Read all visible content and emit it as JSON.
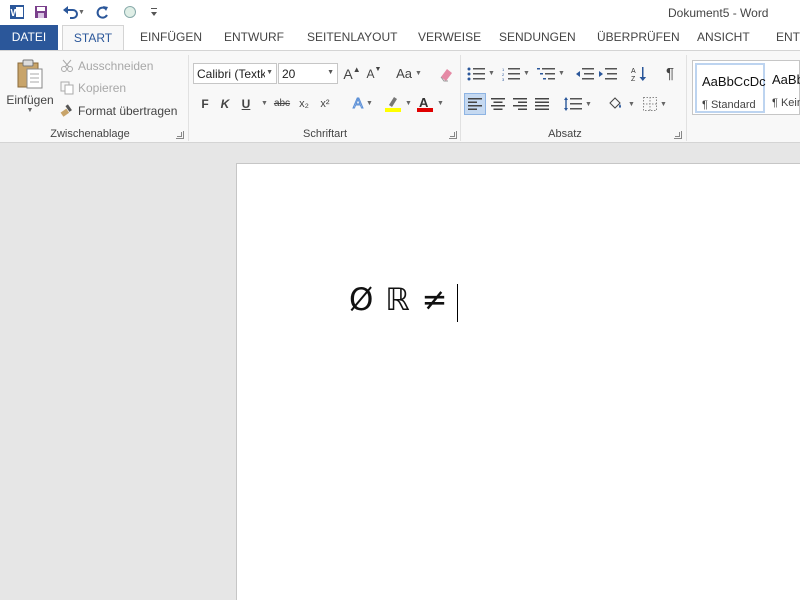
{
  "window": {
    "title": "Dokument5 - Word"
  },
  "quick_access": {
    "word_icon": "word-logo-icon",
    "save_icon": "save-icon",
    "undo_icon": "undo-icon",
    "redo_icon": "redo-icon",
    "touch_icon": "touch-mode-icon",
    "customize_icon": "customize-qat-icon"
  },
  "tabs": [
    {
      "label": "DATEI"
    },
    {
      "label": "START"
    },
    {
      "label": "EINFÜGEN"
    },
    {
      "label": "ENTWURF"
    },
    {
      "label": "SEITENLAYOUT"
    },
    {
      "label": "VERWEISE"
    },
    {
      "label": "SENDUNGEN"
    },
    {
      "label": "ÜBERPRÜFEN"
    },
    {
      "label": "ANSICHT"
    },
    {
      "label": "ENTW"
    }
  ],
  "clipboard": {
    "paste_label": "Einfügen",
    "cut_label": "Ausschneiden",
    "copy_label": "Kopieren",
    "format_painter_label": "Format übertragen",
    "group_label": "Zwischenablage"
  },
  "font": {
    "font_name": "Calibri (Textk",
    "font_size": "20",
    "bold": "F",
    "italic": "K",
    "underline": "U",
    "strike": "abc",
    "subscript": "x₂",
    "superscript": "x²",
    "grow": "A",
    "shrink": "A",
    "case": "Aa",
    "effects": "A",
    "font_color": "A",
    "highlight_color": "#ffff00",
    "font_color_value": "#e00000",
    "group_label": "Schriftart"
  },
  "paragraph": {
    "group_label": "Absatz",
    "pilcrow": "¶"
  },
  "styles": {
    "items": [
      {
        "sample": "AaBbCcDc",
        "name": "¶ Standard"
      },
      {
        "sample": "AaBbCcDc",
        "name": "¶ Kein"
      }
    ]
  },
  "document": {
    "text": "Ø ℝ ≠ "
  },
  "colors": {
    "accent": "#2b579a"
  }
}
